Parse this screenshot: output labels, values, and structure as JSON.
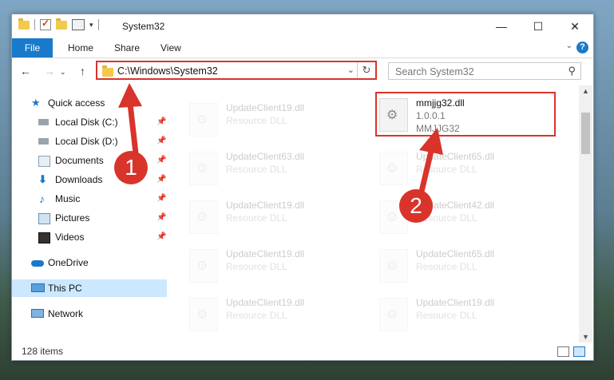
{
  "window": {
    "title": "System32",
    "controls": {
      "minimize": "—",
      "maximize": "☐",
      "close": "✕"
    }
  },
  "ribbon": {
    "file": "File",
    "tabs": [
      "Home",
      "Share",
      "View"
    ],
    "help": "?"
  },
  "navbar": {
    "address": "C:\\Windows\\System32",
    "search_placeholder": "Search System32"
  },
  "sidebar": {
    "items": [
      {
        "label": "Quick access",
        "icon": "star-icon",
        "pinned": false
      },
      {
        "label": "Local Disk (C:)",
        "icon": "drive-icon",
        "pinned": true
      },
      {
        "label": "Local Disk (D:)",
        "icon": "drive-icon",
        "pinned": true
      },
      {
        "label": "Documents",
        "icon": "documents-icon",
        "pinned": true
      },
      {
        "label": "Downloads",
        "icon": "download-icon",
        "pinned": true
      },
      {
        "label": "Music",
        "icon": "music-icon",
        "pinned": true
      },
      {
        "label": "Pictures",
        "icon": "pictures-icon",
        "pinned": true
      },
      {
        "label": "Videos",
        "icon": "videos-icon",
        "pinned": true
      },
      {
        "label": "OneDrive",
        "icon": "cloud-icon",
        "pinned": false
      },
      {
        "label": "This PC",
        "icon": "computer-icon",
        "pinned": false,
        "selected": true
      },
      {
        "label": "Network",
        "icon": "network-icon",
        "pinned": false
      }
    ]
  },
  "files": [
    {
      "name": "UpdateClient19.dll",
      "type": "Resource DLL"
    },
    {
      "name": "mmjjg32.dll",
      "version": "1.0.0.1",
      "company": "MMJJG32"
    },
    {
      "name": "UpdateClient63.dll",
      "type": "Resource DLL"
    },
    {
      "name": "UpdateClient65.dll",
      "type": "Resource DLL"
    },
    {
      "name": "UpdateClient19.dll",
      "type": "Resource DLL"
    },
    {
      "name": "UpdateClient42.dll",
      "type": "Resource DLL"
    },
    {
      "name": "UpdateClient19.dll",
      "type": "Resource DLL"
    },
    {
      "name": "UpdateClient65.dll",
      "type": "Resource DLL"
    },
    {
      "name": "UpdateClient19.dll",
      "type": "Resource DLL"
    },
    {
      "name": "UpdateClient19.dll",
      "type": "Resource DLL"
    }
  ],
  "status": {
    "item_count": "128 items"
  },
  "callouts": {
    "one": "1",
    "two": "2"
  },
  "colors": {
    "accent": "#1979ca",
    "highlight": "#d9342b",
    "selected": "#cce8ff"
  }
}
